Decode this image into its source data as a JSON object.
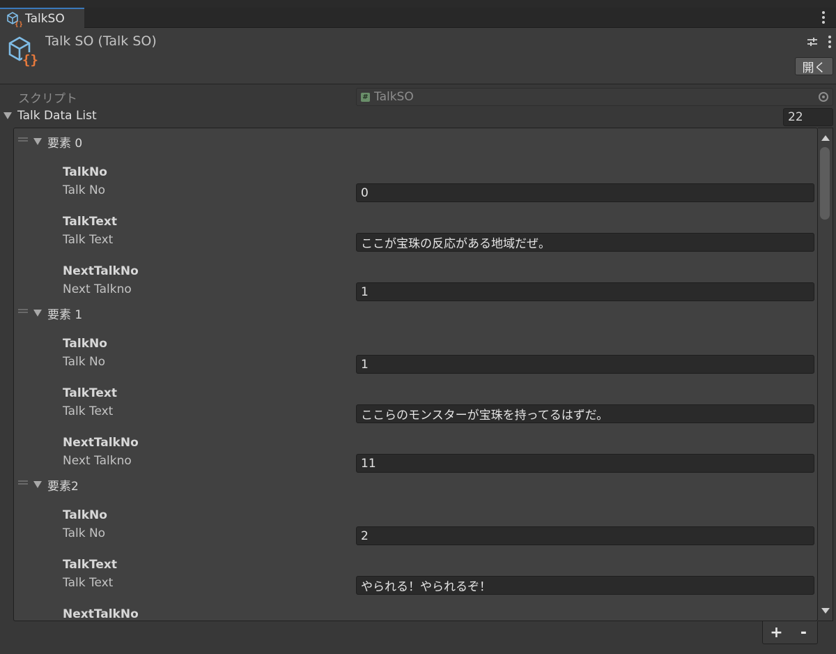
{
  "tab": {
    "title": "TalkSO"
  },
  "header": {
    "title": "Talk SO (Talk SO)",
    "open_button": "開く"
  },
  "script_row": {
    "label": "スクリプト",
    "value": "TalkSO"
  },
  "list": {
    "label": "Talk Data List",
    "size": "22"
  },
  "elements": [
    {
      "label": "要素 0",
      "fields": [
        {
          "header": "TalkNo",
          "label": "Talk No",
          "value": "0"
        },
        {
          "header": "TalkText",
          "label": "Talk Text",
          "value": "ここが宝珠の反応がある地域だぜ。"
        },
        {
          "header": "NextTalkNo",
          "label": "Next Talkno",
          "value": "1"
        }
      ]
    },
    {
      "label": "要素 1",
      "fields": [
        {
          "header": "TalkNo",
          "label": "Talk No",
          "value": "1"
        },
        {
          "header": "TalkText",
          "label": "Talk Text",
          "value": "ここらのモンスターが宝珠を持ってるはずだ。"
        },
        {
          "header": "NextTalkNo",
          "label": "Next Talkno",
          "value": "11"
        }
      ]
    },
    {
      "label": "要素2",
      "fields": [
        {
          "header": "TalkNo",
          "label": "Talk No",
          "value": "2"
        },
        {
          "header": "TalkText",
          "label": "Talk Text",
          "value": "やられる！やられるぞ！"
        },
        {
          "header": "NextTalkNo",
          "label": "",
          "value": ""
        }
      ]
    }
  ],
  "footer": {
    "add": "+",
    "remove": "-"
  },
  "colors": {
    "accent": "#3a79bb",
    "icon_blue": "#7fbce6",
    "icon_orange": "#e87a3c"
  }
}
